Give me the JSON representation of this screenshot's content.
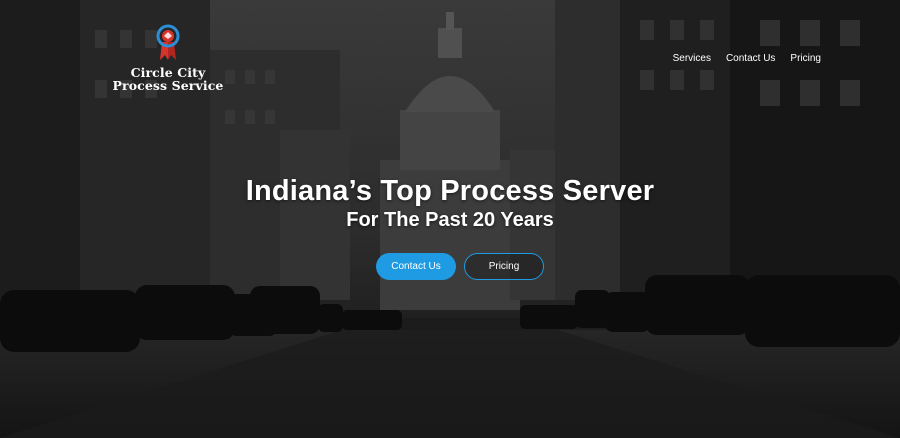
{
  "brand": {
    "name_line1": "Circle City",
    "name_line2": "Process Service",
    "logo_icon": "ribbon-badge-icon",
    "colors": {
      "ring": "#2a8fd6",
      "ribbon": "#d9342b"
    }
  },
  "nav": {
    "items": [
      {
        "label": "Services"
      },
      {
        "label": "Contact Us"
      },
      {
        "label": "Pricing"
      }
    ]
  },
  "hero": {
    "headline": "Indiana’s Top Process Server",
    "subheadline": "For The Past 20 Years",
    "primary_button": "Contact Us",
    "secondary_button": "Pricing",
    "accent_color": "#1e9be3"
  }
}
